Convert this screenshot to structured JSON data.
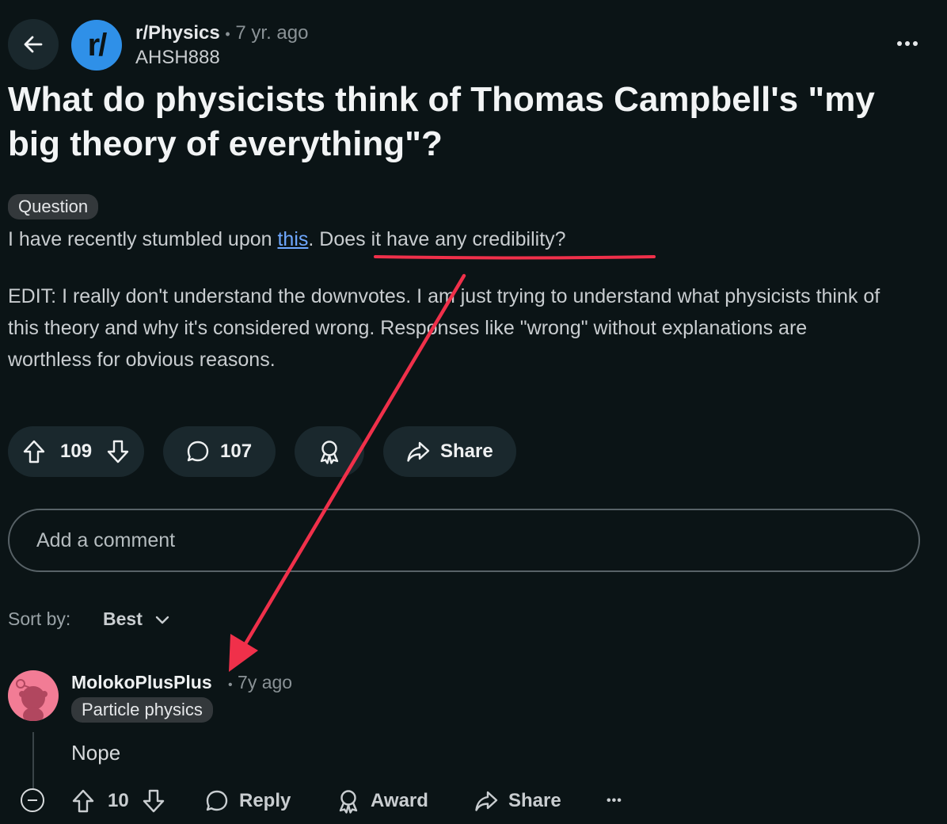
{
  "post": {
    "subreddit": "r/Physics",
    "subreddit_avatar": "r/",
    "separator": "•",
    "age": "7 yr. ago",
    "author": "AHSH888",
    "title": "What do physicists think of Thomas Campbell's \"my big theory of everything\"?",
    "flair": "Question",
    "body_pre": "I have recently stumbled upon ",
    "body_link": "this",
    "body_mid": ". ",
    "body_highlight": "Does it have any credibility?",
    "edit": "EDIT: I really don't understand the downvotes. I am just trying to understand what physicists think of this theory and why it's considered wrong. Responses like \"wrong\" without explanations are worthless for obvious reasons."
  },
  "actions": {
    "votes": "109",
    "comments": "107",
    "share": "Share"
  },
  "comment_input": {
    "placeholder": "Add a comment"
  },
  "sort": {
    "label": "Sort by:",
    "value": "Best"
  },
  "comment": {
    "author": "MolokoPlusPlus",
    "separator": "•",
    "age": "7y ago",
    "flair": "Particle physics",
    "text": "Nope",
    "votes": "10",
    "reply": "Reply",
    "award": "Award",
    "share": "Share",
    "more": "•••"
  },
  "colors": {
    "background": "#0b1416",
    "accent_link": "#6fa8ff",
    "annotation_red": "#f0304a",
    "subreddit_blue": "#2f90e8"
  },
  "annotation": {
    "type": "red-underline-and-arrow",
    "points_to": "comment-author"
  }
}
